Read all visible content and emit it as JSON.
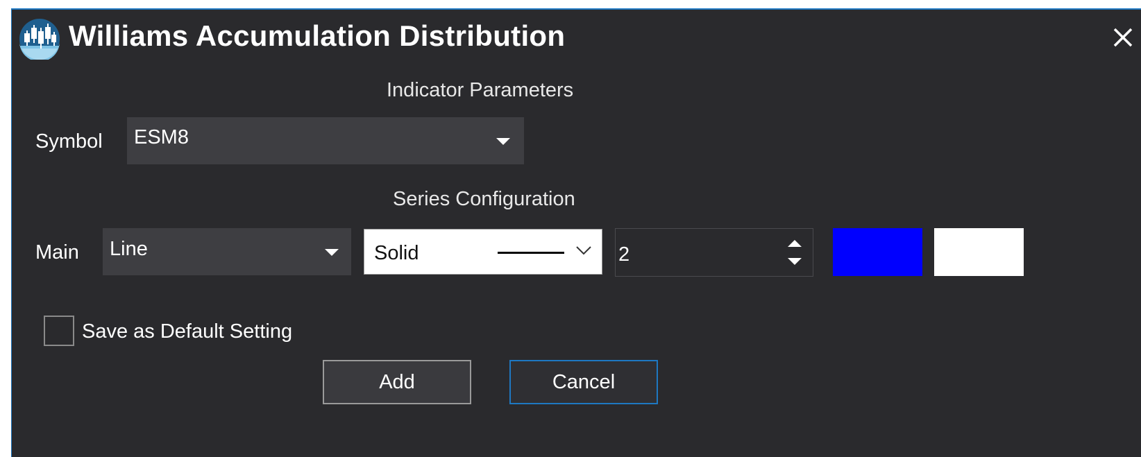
{
  "window": {
    "title": "Williams Accumulation Distribution",
    "icon": "candlestick-chart-icon",
    "close_icon": "close-icon",
    "accent": "#1e78c2",
    "background": "#2a2a2d"
  },
  "indicator_parameters": {
    "heading": "Indicator Parameters",
    "symbol_label": "Symbol",
    "symbol_value": "ESM8"
  },
  "series_configuration": {
    "heading": "Series Configuration",
    "main_label": "Main",
    "type_value": "Line",
    "line_style_value": "Solid",
    "width_value": "2",
    "primary_color": "#0000ff",
    "secondary_color": "#ffffff"
  },
  "options": {
    "save_default_label": "Save as Default Setting",
    "save_default_checked": false
  },
  "buttons": {
    "add_label": "Add",
    "cancel_label": "Cancel"
  }
}
